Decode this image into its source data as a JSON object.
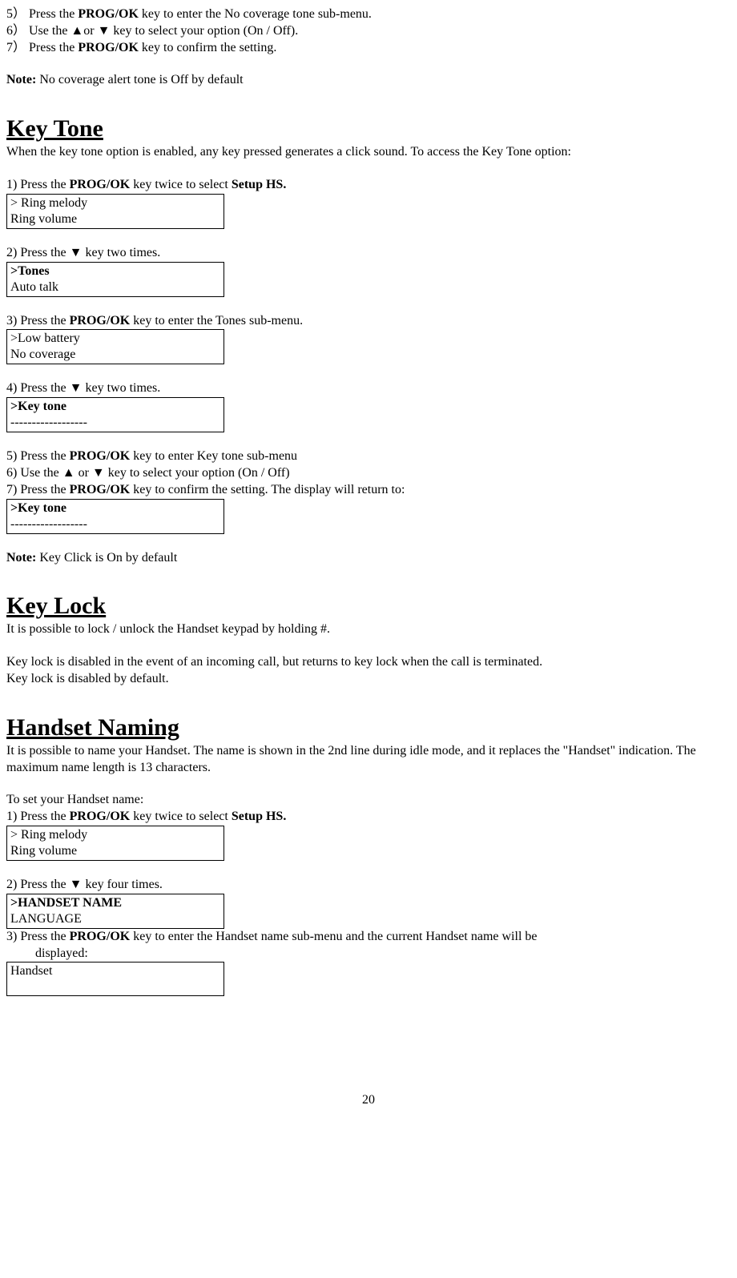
{
  "continuedSteps": {
    "s5": "5） Press the ",
    "s5key": "PROG/OK",
    "s5rest": " key to enter the No coverage tone sub-menu.",
    "s6": "6） Use the ▲or ▼ key to select your option (On / Off).",
    "s7": "7） Press the ",
    "s7key": "PROG/OK",
    "s7rest": " key to confirm the setting."
  },
  "note1label": "Note:",
  "note1text": " No coverage alert tone is Off by default",
  "keyTone": {
    "heading": "Key Tone",
    "intro": "When the key tone option is enabled, any key pressed generates a click sound. To access the Key Tone option:",
    "step1": "1)    Press the ",
    "step1key": "PROG/OK",
    "step1rest": " key twice to select ",
    "step1bold": "Setup HS.",
    "display1_line1": "> Ring melody",
    "display1_line2": "Ring volume",
    "step2": "2)    Press the ▼ key two times.",
    "display2_line1": ">Tones",
    "display2_line2": "Auto talk",
    "step3": "3)    Press the ",
    "step3key": "PROG/OK",
    "step3rest": " key to enter the Tones sub-menu.",
    "display3_line1": ">Low battery",
    "display3_line2": " No coverage",
    "step4": "4)    Press the ▼ key two times.",
    "display4_line1": ">Key tone",
    "display4_line2": "------------------",
    "step5": "5)    Press the ",
    "step5key": "PROG/OK",
    "step5rest": " key to enter Key tone sub-menu",
    "step6": "6)    Use the ▲ or ▼ key to select your option (On / Off)",
    "step7": "7)    Press the ",
    "step7key": "PROG/OK",
    "step7rest": " key to confirm the setting.  The display will return to:",
    "display5_line1": ">Key tone",
    "display5_line2": "------------------",
    "note2label": "Note:",
    "note2text": "  Key Click is On by default"
  },
  "keyLock": {
    "heading": "Key Lock",
    "text1": "It is possible to lock / unlock the Handset keypad by holding #.",
    "text2": "Key lock is disabled in the event of an incoming call, but returns to key lock when the call is terminated.",
    "text3": "Key lock is disabled by default."
  },
  "handsetNaming": {
    "heading": "Handset Naming",
    "intro": "It is possible to name your Handset. The name is shown in the 2nd line during idle mode, and it replaces the \"Handset\" indication.  The maximum name length is 13 characters.",
    "toset": "To set your Handset name:",
    "step1": "1)    Press the ",
    "step1key": "PROG/OK",
    "step1rest": " key twice to select ",
    "step1bold": "Setup HS.",
    "display1_line1": "> Ring melody",
    "display1_line2": "Ring volume",
    "step2": "2)    Press the ▼ key four times.",
    "display2_line1": ">HANDSET NAME",
    "display2_line2": " LANGUAGE",
    "step3pre": "3)    Press the ",
    "step3key": "PROG/OK",
    "step3rest": " key to enter the Handset name sub-menu and the current Handset name will be",
    "step3line2": "displayed:",
    "display3_line1": "Handset",
    "display3_line2": ""
  },
  "pageNum": "20"
}
